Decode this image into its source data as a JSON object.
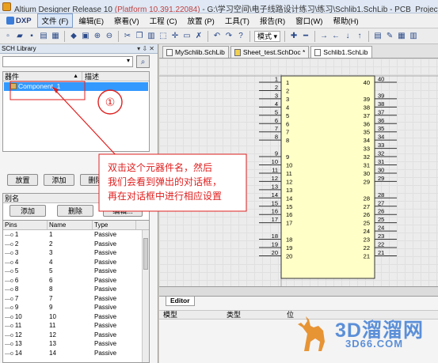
{
  "window": {
    "title_prefix": "Altium Designer Release 10",
    "title_platform": "(Platform 10.391.22084)",
    "title_suffix": "- G:\\学习空间\\电子线路设计练习\\练习\\Schlib1.SchLib - PCB_Project_test.PrjPCB."
  },
  "menu": {
    "dxp": "DXP",
    "items": [
      "文件 (F)",
      "编辑(E)",
      "察看(V)",
      "工程 (C)",
      "放置 (P)",
      "工具(T)",
      "报告(R)",
      "窗口(W)",
      "帮助(H)"
    ]
  },
  "toolbar": {
    "mode_label": "模式 ▾"
  },
  "sch_library": {
    "panel_title": "SCH Library",
    "components_header": "器件",
    "description_header": "描述",
    "components": [
      {
        "name": "Component_1"
      }
    ],
    "buttons": {
      "place": "放置",
      "add": "添加",
      "delete": "删除",
      "edit": "编辑..."
    },
    "aliases_header": "别名",
    "alias_buttons": {
      "add": "添加",
      "delete": "删除",
      "edit": "编辑..."
    },
    "pins_headers": {
      "pins": "Pins",
      "name": "Name",
      "type": "Type"
    },
    "pins": [
      {
        "pin": "1",
        "name": "1",
        "type": "Passive"
      },
      {
        "pin": "2",
        "name": "2",
        "type": "Passive"
      },
      {
        "pin": "3",
        "name": "3",
        "type": "Passive"
      },
      {
        "pin": "4",
        "name": "4",
        "type": "Passive"
      },
      {
        "pin": "5",
        "name": "5",
        "type": "Passive"
      },
      {
        "pin": "6",
        "name": "6",
        "type": "Passive"
      },
      {
        "pin": "8",
        "name": "8",
        "type": "Passive"
      },
      {
        "pin": "7",
        "name": "7",
        "type": "Passive"
      },
      {
        "pin": "9",
        "name": "9",
        "type": "Passive"
      },
      {
        "pin": "10",
        "name": "10",
        "type": "Passive"
      },
      {
        "pin": "11",
        "name": "11",
        "type": "Passive"
      },
      {
        "pin": "12",
        "name": "12",
        "type": "Passive"
      },
      {
        "pin": "13",
        "name": "13",
        "type": "Passive"
      },
      {
        "pin": "14",
        "name": "14",
        "type": "Passive"
      }
    ]
  },
  "doc_tabs": [
    "MySchlib.SchLib",
    "Sheet_test.SchDoc *",
    "Schlib1.SchLib"
  ],
  "schematic": {
    "left_pins": [
      "1",
      "2",
      "3",
      "4",
      "5",
      "6",
      "7",
      "8",
      "9",
      "10",
      "11",
      "12",
      "13",
      "14",
      "15",
      "16",
      "17",
      "18",
      "19",
      "20"
    ],
    "right_pins": [
      "40",
      "39",
      "38",
      "37",
      "36",
      "35",
      "34",
      "33",
      "32",
      "31",
      "30",
      "29",
      "28",
      "27",
      "26",
      "25",
      "24",
      "23",
      "22",
      "21"
    ]
  },
  "annotation": {
    "marker": "①",
    "lines": [
      "双击这个元器件名，然后",
      "我们会看到弹出的对话框，",
      "再在对话框中进行相应设置"
    ]
  },
  "editor": {
    "tab_label": "Editor",
    "columns": [
      "模型",
      "类型",
      "位"
    ]
  },
  "watermark": {
    "brand": "3D溜溜网",
    "url": "3D66.COM"
  },
  "colors": {
    "selection": "#3399ff",
    "annotation_red": "#e02020",
    "watermark_blue": "#5b8fd8"
  }
}
